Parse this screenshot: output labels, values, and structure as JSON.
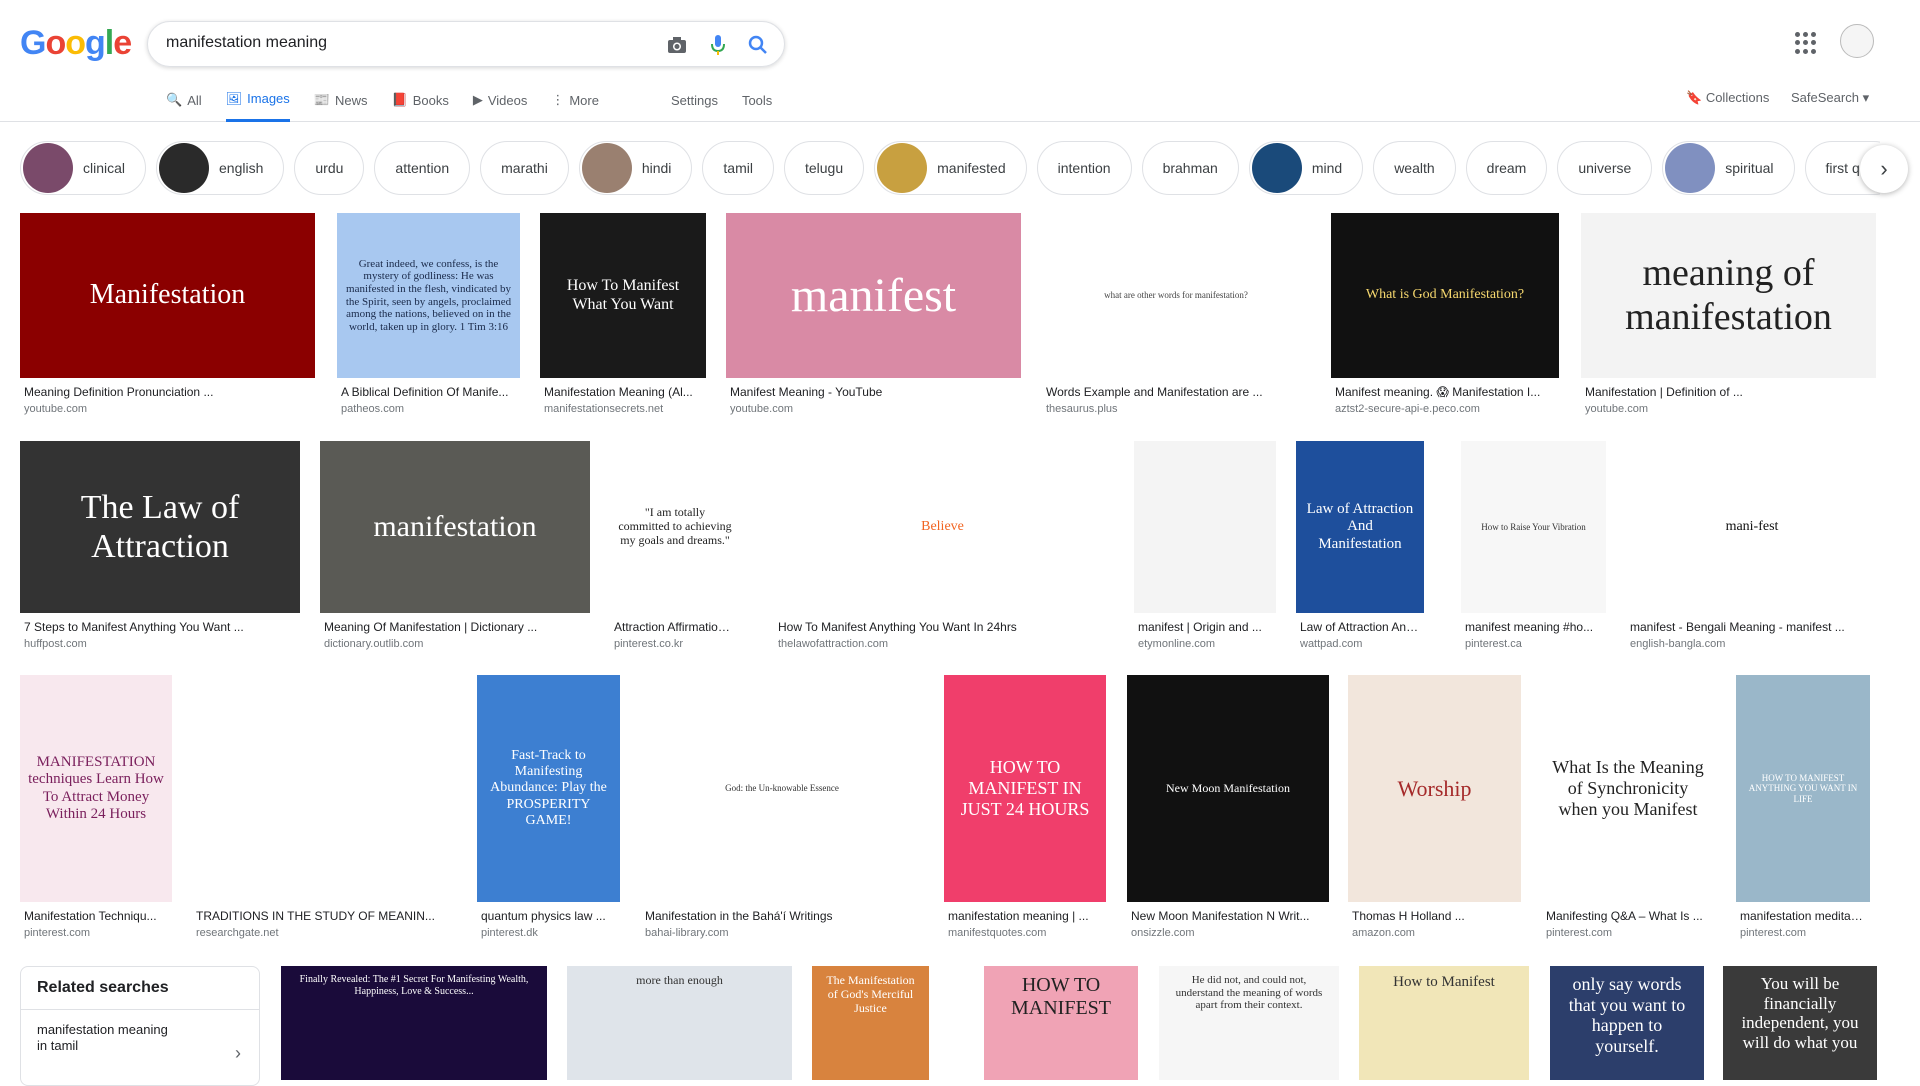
{
  "logo_letters": [
    "G",
    "o",
    "o",
    "g",
    "l",
    "e"
  ],
  "search": {
    "value": "manifestation meaning"
  },
  "tabs": [
    {
      "label": "All",
      "icon": "search-icon"
    },
    {
      "label": "Images",
      "icon": "image-icon",
      "active": true
    },
    {
      "label": "News",
      "icon": "news-icon"
    },
    {
      "label": "Books",
      "icon": "book-icon"
    },
    {
      "label": "Videos",
      "icon": "video-icon"
    },
    {
      "label": "More",
      "icon": "more-vert-icon"
    }
  ],
  "tools": {
    "settings": "Settings",
    "tools": "Tools"
  },
  "right": {
    "collections": "Collections",
    "safesearch": "SafeSearch"
  },
  "chips": [
    {
      "label": "clinical",
      "thumb": true
    },
    {
      "label": "english",
      "thumb": true
    },
    {
      "label": "urdu"
    },
    {
      "label": "attention"
    },
    {
      "label": "marathi"
    },
    {
      "label": "hindi",
      "thumb": true
    },
    {
      "label": "tamil"
    },
    {
      "label": "telugu"
    },
    {
      "label": "manifested",
      "thumb": true
    },
    {
      "label": "intention"
    },
    {
      "label": "brahman"
    },
    {
      "label": "mind",
      "thumb": true
    },
    {
      "label": "wealth"
    },
    {
      "label": "dream"
    },
    {
      "label": "universe"
    },
    {
      "label": "spiritual",
      "thumb": true
    },
    {
      "label": "first quar"
    }
  ],
  "results": [
    {
      "caption": "Meaning Definition Pronunciation ...",
      "source": "youtube.com",
      "text": "Manifestation",
      "bg": "#8b0000",
      "fg": "#ffffff"
    },
    {
      "caption": "A Biblical Definition Of Manife...",
      "source": "patheos.com",
      "text": "Great indeed, we confess, is the mystery of godliness: He was manifested in the flesh, vindicated by the Spirit, seen by angels, proclaimed among the nations, believed on in the world, taken up in glory. 1 Tim 3:16",
      "bg": "#a8c8f0",
      "fg": "#1a2a4a"
    },
    {
      "caption": "Manifestation Meaning (Al...",
      "source": "manifestationsecrets.net",
      "text": "How To Manifest What You Want",
      "bg": "#1a1a1a",
      "fg": "#ffffff"
    },
    {
      "caption": "Manifest Meaning - YouTube",
      "source": "youtube.com",
      "text": "manifest",
      "bg": "#d98aa5",
      "fg": "#ffffff"
    },
    {
      "caption": "Words Example and Manifestation are ...",
      "source": "thesaurus.plus",
      "text": "what are other words for manifestation?",
      "bg": "#ffffff",
      "fg": "#444444"
    },
    {
      "caption": "Manifest meaning. 😱 Manifestation I...",
      "source": "aztst2-secure-api-e.peco.com",
      "text": "What is God Manifestation?",
      "bg": "#111111",
      "fg": "#f5d76e"
    },
    {
      "caption": "Manifestation | Definition of ...",
      "source": "youtube.com",
      "text": "meaning of manifestation",
      "bg": "#f3f3f3",
      "fg": "#222222"
    },
    {
      "caption": "7 Steps to Manifest Anything You Want ...",
      "source": "huffpost.com",
      "text": "The Law of Attraction",
      "bg": "#333333",
      "fg": "#ffffff"
    },
    {
      "caption": "Meaning Of Manifestation | Dictionary ...",
      "source": "dictionary.outlib.com",
      "text": "manifestation",
      "bg": "#5a5a55",
      "fg": "#ffffff"
    },
    {
      "caption": "Attraction Affirmation ...",
      "source": "pinterest.co.kr",
      "text": "\"I am totally committed to achieving my goals and dreams.\"",
      "bg": "#ffffff",
      "fg": "#222222"
    },
    {
      "caption": "How To Manifest Anything You Want In 24hrs",
      "source": "thelawofattraction.com",
      "text": "Believe",
      "bg": "#ffffff",
      "fg": "#f26522"
    },
    {
      "caption": "manifest | Origin and ...",
      "source": "etymonline.com",
      "text": "",
      "bg": "#f4f4f4",
      "fg": "#666666"
    },
    {
      "caption": "Law of Attraction And ...",
      "source": "wattpad.com",
      "text": "Law of Attraction And Manifestation",
      "bg": "#1e4f9c",
      "fg": "#ffffff"
    },
    {
      "caption": "manifest meaning #ho...",
      "source": "pinterest.ca",
      "text": "How to Raise Your Vibration",
      "bg": "#f7f7f7",
      "fg": "#333333"
    },
    {
      "caption": "manifest - Bengali Meaning - manifest ...",
      "source": "english-bangla.com",
      "text": "mani-fest",
      "bg": "#ffffff",
      "fg": "#111111"
    },
    {
      "caption": "Manifestation Techniqu...",
      "source": "pinterest.com",
      "text": "MANIFESTATION techniques Learn How To Attract Money Within 24 Hours",
      "bg": "#f8e8ee",
      "fg": "#7a1f5c"
    },
    {
      "caption": "TRADITIONS IN THE STUDY OF MEANIN...",
      "source": "researchgate.net",
      "text": "",
      "bg": "#ffffff",
      "fg": "#333333"
    },
    {
      "caption": "quantum physics law ...",
      "source": "pinterest.dk",
      "text": "Fast-Track to Manifesting Abundance: Play the PROSPERITY GAME!",
      "bg": "#3d7fd1",
      "fg": "#ffffff"
    },
    {
      "caption": "Manifestation in the Bahá'í Writings",
      "source": "bahai-library.com",
      "text": "God: the Un-knowable Essence",
      "bg": "#ffffff",
      "fg": "#333333"
    },
    {
      "caption": "manifestation meaning | ...",
      "source": "manifestquotes.com",
      "text": "HOW TO MANIFEST IN JUST 24 HOURS",
      "bg": "#f03e6b",
      "fg": "#ffffff"
    },
    {
      "caption": "New Moon Manifestation N Writ...",
      "source": "onsizzle.com",
      "text": "New Moon Manifestation",
      "bg": "#111111",
      "fg": "#ffffff"
    },
    {
      "caption": "Thomas H Holland ...",
      "source": "amazon.com",
      "text": "Worship",
      "bg": "#f2e6dc",
      "fg": "#a52a2a"
    },
    {
      "caption": "Manifesting Q&A – What Is ...",
      "source": "pinterest.com",
      "text": "What Is the Meaning of Synchronicity when you Manifest",
      "bg": "#ffffff",
      "fg": "#222222"
    },
    {
      "caption": "manifestation meditati...",
      "source": "pinterest.com",
      "text": "HOW TO MANIFEST ANYTHING YOU WANT IN LIFE",
      "bg": "#9ab7c9",
      "fg": "#ffffff"
    }
  ],
  "related": {
    "title": "Related searches",
    "item": "manifestation meaning in tamil"
  },
  "bottom_row": [
    {
      "text": "Finally Revealed: The #1 Secret For Manifesting Wealth, Happiness, Love & Success...",
      "bg": "#1a0b3a",
      "fg": "#ffffff"
    },
    {
      "text": "more than enough",
      "bg": "#dfe4ea",
      "fg": "#333333"
    },
    {
      "text": "The Manifestation of God's Merciful Justice",
      "bg": "#d8833e",
      "fg": "#ffffff"
    },
    {
      "text": "HOW TO MANIFEST",
      "bg": "#f0a3b5",
      "fg": "#222222"
    },
    {
      "text": "He did not, and could not, understand the meaning of words apart from their context.",
      "bg": "#f6f6f6",
      "fg": "#333333"
    },
    {
      "text": "How to Manifest",
      "bg": "#f1e6b8",
      "fg": "#333333"
    },
    {
      "text": "only say words that you want to happen to yourself.",
      "bg": "#2c3e6b",
      "fg": "#ffffff"
    },
    {
      "text": "You will be financially independent, you will do what you",
      "bg": "#3a3a3a",
      "fg": "#ffffff"
    }
  ]
}
